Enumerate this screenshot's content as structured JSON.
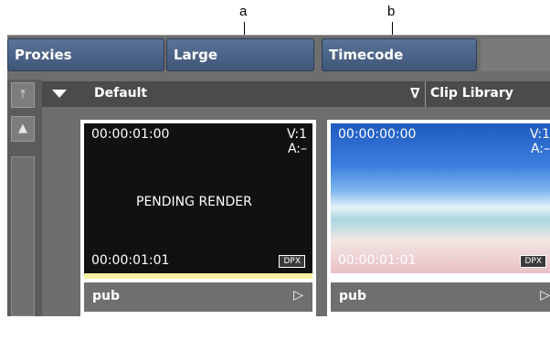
{
  "callouts": {
    "a": "a",
    "b": "b"
  },
  "toolbar": {
    "view_label": "Proxies",
    "size_label": "Large",
    "overlay_label": "Timecode"
  },
  "filter_bar": {
    "filter_name": "Default",
    "library_label": "Clip Library",
    "library_menu_glyph": "∇"
  },
  "rail": {
    "top_icon": "arrow-to-top-icon",
    "up_icon": "arrow-up-icon",
    "top_glyph": "⤒",
    "up_glyph": "▲"
  },
  "clips": [
    {
      "tc_in": "00:00:01:00",
      "video_track": "V:1",
      "audio_track": "A:–",
      "status": "PENDING RENDER",
      "tc_out": "00:00:01:01",
      "format": "DPX",
      "label": "pub",
      "play_glyph": "▷"
    },
    {
      "tc_in": "00:00:00:00",
      "video_track": "V:1",
      "audio_track": "A:–",
      "status": "",
      "tc_out": "00:00:01:01",
      "format": "DPX",
      "label": "pub",
      "play_glyph": "▷"
    }
  ],
  "colors": {
    "button": "#4a6288",
    "panel": "#6e6e6e",
    "pending_bar": "#f5f0a0"
  }
}
